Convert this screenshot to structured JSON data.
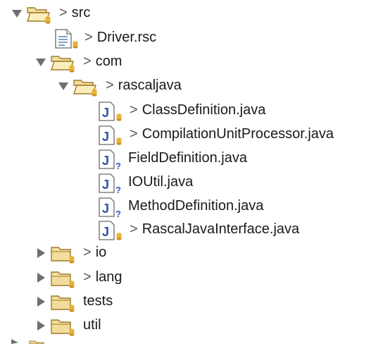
{
  "package_explorer": {
    "items": [
      {
        "name": "src",
        "kind": "folder",
        "state": "expanded",
        "outgoing": true
      },
      {
        "name": "Driver.rsc",
        "kind": "file",
        "outgoing": true
      },
      {
        "name": "com",
        "kind": "folder",
        "state": "expanded",
        "outgoing": true
      },
      {
        "name": "rascaljava",
        "kind": "folder",
        "state": "expanded",
        "outgoing": true
      },
      {
        "name": "ClassDefinition.java",
        "kind": "java",
        "status": "versioned",
        "outgoing": true
      },
      {
        "name": "CompilationUnitProcessor.java",
        "kind": "java",
        "status": "versioned",
        "outgoing": true
      },
      {
        "name": "FieldDefinition.java",
        "kind": "java",
        "status": "unversioned",
        "outgoing": false
      },
      {
        "name": "IOUtil.java",
        "kind": "java",
        "status": "unversioned",
        "outgoing": false
      },
      {
        "name": "MethodDefinition.java",
        "kind": "java",
        "status": "unversioned",
        "outgoing": false
      },
      {
        "name": "RascalJavaInterface.java",
        "kind": "java",
        "status": "versioned",
        "outgoing": true
      },
      {
        "name": "io",
        "kind": "folder",
        "state": "collapsed",
        "outgoing": true
      },
      {
        "name": "lang",
        "kind": "folder",
        "state": "collapsed",
        "outgoing": true
      },
      {
        "name": "tests",
        "kind": "folder",
        "state": "collapsed",
        "outgoing": false
      },
      {
        "name": "util",
        "kind": "folder",
        "state": "collapsed",
        "outgoing": false
      }
    ],
    "outgoing_marker": ">",
    "unversioned_marker": "?"
  },
  "colors": {
    "folder_fill": "#f3dd9d",
    "folder_stroke": "#a07a2a",
    "cylinder": "#e8b23c",
    "java_blue": "#2f4fa3",
    "unversioned_blue": "#3a4fc7",
    "twisty": "#6e6e6e"
  }
}
